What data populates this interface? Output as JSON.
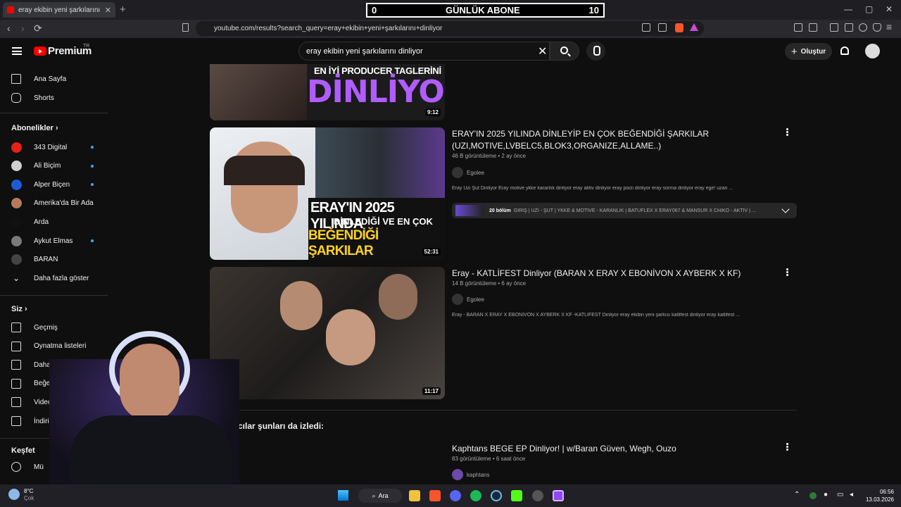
{
  "browser": {
    "tab_title": "eray ekibin yeni şarkılarını dinliyor - YouTube",
    "tab_close": "✕",
    "new_tab": "+",
    "url": "youtube.com/results?search_query=eray+ekibin+yeni+şarkılarını+dinliyor",
    "window_controls": [
      "—",
      "▢",
      "✕"
    ]
  },
  "overlay_counter": {
    "left": "0",
    "label": "GÜNLÜK ABONE",
    "right": "10"
  },
  "header": {
    "logo": "Premium",
    "country": "TR",
    "search_query": "eray ekibin yeni şarkılarını dinliyor",
    "create_label": "Oluştur"
  },
  "sidebar": {
    "main": [
      {
        "label": "Ana Sayfa",
        "icon": "home-icon"
      },
      {
        "label": "Shorts",
        "icon": "shorts-icon"
      }
    ],
    "subscriptions_header": "Abonelikler",
    "subscriptions": [
      {
        "label": "343 Digital",
        "color": "#e62117",
        "dot": true
      },
      {
        "label": "Ali Biçim",
        "color": "#cfcfcf",
        "dot": true
      },
      {
        "label": "Alper Biçen",
        "color": "#1e5bd8",
        "dot": true
      },
      {
        "label": "Amerika'da Bir Ada",
        "color": "#b77a5a",
        "dot": false
      },
      {
        "label": "Arda",
        "color": "#111111",
        "dot": false
      },
      {
        "label": "Aykut Elmas",
        "color": "#7a7a7a",
        "dot": true
      },
      {
        "label": "BARAN",
        "color": "#444444",
        "dot": false
      }
    ],
    "show_more": "Daha fazla göster",
    "you_header": "Siz",
    "you_items": [
      {
        "label": "Geçmiş",
        "icon": "history-icon"
      },
      {
        "label": "Oynatma listeleri",
        "icon": "playlist-icon"
      },
      {
        "label": "Daha sonra izle",
        "icon": "watch-later-icon"
      },
      {
        "label": "Beğendiğim v",
        "icon": "like-icon"
      },
      {
        "label": "Videolar",
        "icon": "video-icon"
      },
      {
        "label": "İndiri",
        "icon": "download-icon"
      }
    ],
    "explore_header": "Keşfet",
    "explore_items": [
      {
        "label": "Mü",
        "icon": "music-icon"
      }
    ]
  },
  "results": [
    {
      "thumb_text_1": "EN İYİ PRODUCER TAGLERİNİ",
      "thumb_text_2": "DİNLİYOR",
      "duration": "9:12"
    },
    {
      "title": "ERAY'IN 2025 YILINDA DİNLEYİP EN ÇOK BEĞENDİĞİ ŞARKILAR (UZI,MOTIVE,LVBELC5,BLOK3,ORGANIZE,ALLAME..)",
      "views": "46 B görüntüleme",
      "age": "2 ay önce",
      "channel": "Egolee",
      "snippet": "Eray Uzi Şut Dinliyor Eray motive ykke karanlık dinliyor eray aktiv dinliyor eray poizi dinliyor eray sorma dinliyor eray ege! uzan ...",
      "duration": "52:31",
      "thumb_line_1": "ERAY'IN 2025 YILINDA",
      "thumb_line_2": "DİNLEDİĞİ VE EN ÇOK",
      "thumb_line_3": "BEĞENDİĞİ ŞARKILAR",
      "chapters_count": "20 bölüm",
      "chapters_text": "GİRİŞ | UZI - ŞUT | YKKE & MOTIVE - KARANLIK | BATUFLEX X ERAY067 & MANSUR X CHIKO - AKTIV | ..."
    },
    {
      "title": "Eray - KATLİFEST Dinliyor (BARAN X ERAY X EBONİVON X AYBERK X KF)",
      "views": "14 B görüntüleme",
      "age": "6 ay önce",
      "channel": "Egolee",
      "snippet": "Eray - BARAN X ERAY X EBONİVON X AYBERK X KF -KATLİFEST Dinliyor eray ekibin yeni şarkısı katlifest dinliyor eray katlifest ...",
      "duration": "11:17"
    }
  ],
  "shelf": {
    "title": "Kullanıcılar şunları da izledi:",
    "video": {
      "title": "Kaphtans BEGE EP Dinliyor! | w/Baran Güven, Wegh, Ouzo",
      "views": "83 görüntüleme",
      "age": "6 saat önce",
      "channel": "kaphtans"
    }
  },
  "taskbar": {
    "search_label": "Ara",
    "temp": "8°C",
    "weather": "Çok",
    "time": "06:56",
    "date": "13.03.2026"
  }
}
